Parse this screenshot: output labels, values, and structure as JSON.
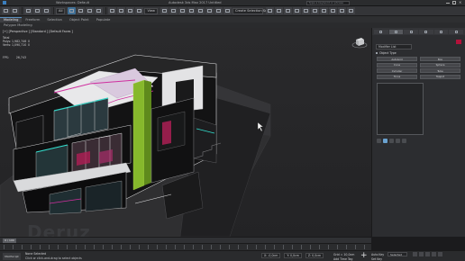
{
  "title_bar": {
    "workspace_label": "Workspaces: Default",
    "file_title": "Autodesk 3ds Max 2017   Untitled",
    "search_placeholder": "Type a keyword or phrase"
  },
  "toolbar": {
    "selection_filter": "All",
    "view_dropdown": "View",
    "named_selection": "Create Selection Se"
  },
  "ribbon": {
    "tabs": [
      "Modeling",
      "Freeform",
      "Selection",
      "Object Paint",
      "Populate"
    ]
  },
  "subribbon": {
    "label": "Polygon Modeling"
  },
  "viewport": {
    "label": "[+] [Perspective ] [Standard ] [Default Faces ]",
    "stats_header": "Total",
    "stats": [
      {
        "key": "Polys:",
        "value": "1,982,746",
        "extra": "0"
      },
      {
        "key": "Verts:",
        "value": "1,090,710",
        "extra": "0"
      }
    ],
    "fps_label": "FPS:",
    "fps_value": "26,743",
    "watermark": "Deruz"
  },
  "command_panel": {
    "object_type_dropdown": "Modifier List",
    "section_header": "Object Type",
    "buttons": [
      "AutoGrid",
      "Box",
      "Cone",
      "Sphere",
      "Cylinder",
      "Tube",
      "Torus",
      "Teapot"
    ],
    "swatch_color": "#b3123a"
  },
  "time_slider": {
    "position": "0 / 100"
  },
  "status_bar": {
    "max_script": "MAXScript",
    "selection_info": "None Selected",
    "hint": "Click or click-and-drag to select objects",
    "x": "X: -0,0cm",
    "y": "Y: 0,0cm",
    "z": "Z: 0,0cm",
    "grid": "Grid = 10,0cm",
    "add_time_tag": "Add Time Tag",
    "auto_key": "Auto Key",
    "key_filter": "Selected",
    "set_key": "Set Key"
  },
  "colors": {
    "accent": "#3f6f96",
    "viewport_bg": "#262628",
    "wall_green": "#86b82c"
  }
}
